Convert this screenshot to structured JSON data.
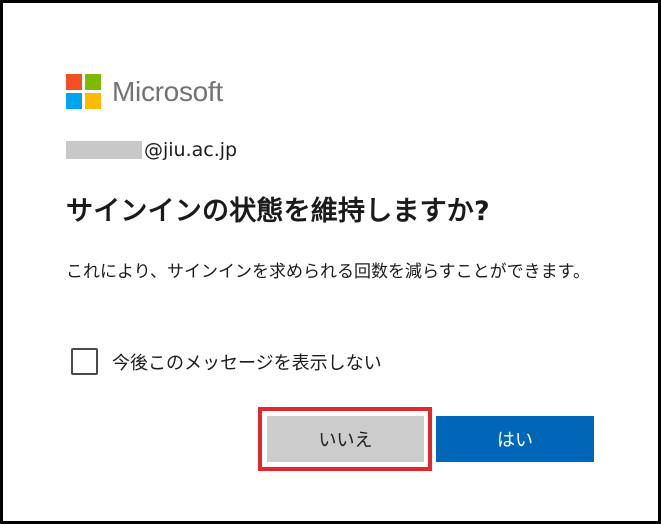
{
  "logo": {
    "text": "Microsoft",
    "colors": [
      "#f25022",
      "#7fba00",
      "#00a4ef",
      "#ffb900"
    ]
  },
  "identity": {
    "email_suffix": "@jiu.ac.jp"
  },
  "dialog": {
    "title": "サインインの状態を維持しますか?",
    "description": "これにより、サインインを求められる回数を減らすことができます。",
    "checkbox_label": "今後このメッセージを表示しない",
    "checkbox_checked": false
  },
  "buttons": {
    "no_label": "いいえ",
    "yes_label": "はい",
    "yes_color": "#0067b8",
    "no_color": "#cccccc",
    "highlight_color": "#e0282e"
  }
}
